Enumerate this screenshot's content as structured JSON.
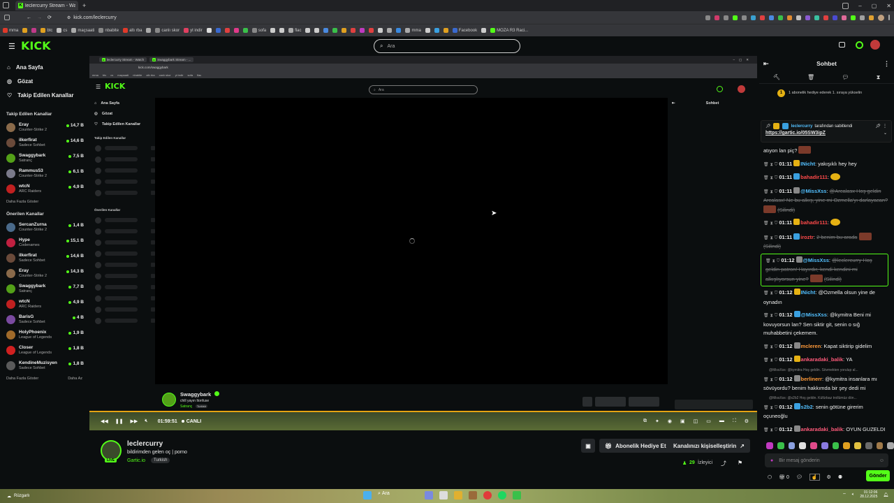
{
  "browser": {
    "tab_title": "leclercurry Stream - Watch",
    "url": "kick.com/leclercurry",
    "bookmarks": [
      "mma",
      "btc",
      "cs",
      "maçsaati",
      "nbabite",
      "altı rba",
      "canlı skor",
      "yt indir",
      "sofa",
      "flac",
      "Facebook",
      "MOZA R3 Raci..."
    ]
  },
  "kick": {
    "logo": "KICK",
    "search_placeholder": "Ara"
  },
  "sidebar": {
    "nav": [
      {
        "label": "Ana Sayfa",
        "icon": "home-icon"
      },
      {
        "label": "Gözat",
        "icon": "browse-icon"
      },
      {
        "label": "Takip Edilen Kanallar",
        "icon": "heart-icon"
      }
    ],
    "followed_title": "Takip Edilen Kanallar",
    "followed": [
      {
        "name": "Eray",
        "game": "Counter-Strike 2",
        "viewers": "14,7 B",
        "color": "#8a6a4a"
      },
      {
        "name": "ilkerfirat",
        "game": "Sadece Sohbet",
        "viewers": "14,6 B",
        "color": "#6a4a3a"
      },
      {
        "name": "Swaggybark",
        "game": "Satranç",
        "viewers": "7,5 B",
        "color": "#53a018"
      },
      {
        "name": "Rammus53",
        "game": "Counter-Strike 2",
        "viewers": "6,1 B",
        "color": "#7a7a8a"
      },
      {
        "name": "wtcN",
        "game": "ARC Raiders",
        "viewers": "4,9 B",
        "color": "#c02020"
      }
    ],
    "show_more": "Daha Fazla Göster",
    "recommended_title": "Önerilen Kanallar",
    "recommended": [
      {
        "name": "SercanZurna",
        "game": "Counter-Strike 2",
        "viewers": "1,4 B",
        "color": "#4a6a8a"
      },
      {
        "name": "Hype",
        "game": "Codenames",
        "viewers": "15,1 B",
        "color": "#c02040"
      },
      {
        "name": "ilkerfirat",
        "game": "Sadece Sohbet",
        "viewers": "14,6 B",
        "color": "#6a4a3a"
      },
      {
        "name": "Eray",
        "game": "Counter-Strike 2",
        "viewers": "14,3 B",
        "color": "#8a6a4a"
      },
      {
        "name": "Swaggybark",
        "game": "Satranç",
        "viewers": "7,7 B",
        "color": "#53a018"
      },
      {
        "name": "wtcN",
        "game": "ARC Raiders",
        "viewers": "4,9 B",
        "color": "#c02020"
      },
      {
        "name": "BarisG",
        "game": "Sadece Sohbet",
        "viewers": "4 B",
        "color": "#7a4aa0"
      },
      {
        "name": "HolyPhoenix",
        "game": "League of Legends",
        "viewers": "1,9 B",
        "color": "#a06a2a"
      },
      {
        "name": "Closer",
        "game": "League of Legends",
        "viewers": "1,8 B",
        "color": "#d02020"
      },
      {
        "name": "KendineMuzisyen",
        "game": "Sadece Sohbet",
        "viewers": "1,8 B",
        "color": "#5a5a5a"
      }
    ],
    "show_more2": "Daha Fazla Göster",
    "show_less": "Daha Az"
  },
  "embedded": {
    "tab1": "leclercurry Stream - Watch",
    "tab2": "Swaggybark Stream - ...",
    "url": "kick.com/swaggybark",
    "search_placeholder": "Ara",
    "nav": [
      "Ana Sayfa",
      "Gözat",
      "Takip Edilen Kanallar"
    ],
    "followed_title": "Takip Edilen Kanallar",
    "recommended_title": "Önerilen Kanallar",
    "chat_title": "Sohbet",
    "streamer": "Swaggybark",
    "stream_title": "chill yayın Itonfuse",
    "category": "Satranç",
    "language": "Turkish",
    "live": "LIVE"
  },
  "player": {
    "time": "01:59:51",
    "live_label": "CANLI"
  },
  "stream": {
    "streamer": "leclercurry",
    "title": "bildirimden gelen oç | porno",
    "category": "Gartic.io",
    "language": "Turkish",
    "live": "LIVE",
    "gift_btn": "Abonelik Hediye Et",
    "customize_btn": "Kanalınızı kişiselleştirin",
    "viewers": "29",
    "viewers_label": "İzleyici"
  },
  "chat": {
    "title": "Sohbet",
    "sub_banner": "1 abonelik hediye ederek 1. sıraya yükselin",
    "pinned_by": "leclercurry",
    "pinned_suffix": "tarafından sabitlendi",
    "pinned_link": "https://gartic.io/05SW3ipZ",
    "messages": [
      {
        "time": "",
        "user": "",
        "user_color": "#eee",
        "text": "atıyon lan piç?",
        "deleted": false
      },
      {
        "time": "01:11",
        "user": "INicht",
        "user_color": "#53c0ff",
        "text": "yakışıklı hey hey",
        "deleted": false
      },
      {
        "time": "01:11",
        "user": "bahadir111",
        "user_color": "#ff4a4a",
        "text": "",
        "deleted": false
      },
      {
        "time": "01:11",
        "user": "@MissXss",
        "user_color": "#53c0ff",
        "text": "@Arcalasx Hoş geldin Arcalasx! Ne bu alkış, yine mi Ozmella'yı darlayacan?",
        "deleted": true,
        "deleted_label": "(Silindi)"
      },
      {
        "time": "01:11",
        "user": "bahadir111",
        "user_color": "#ff4a4a",
        "text": "",
        "deleted": false
      },
      {
        "time": "01:11",
        "user": "iroztr",
        "user_color": "#ff4a4a",
        "text": "2 benim bu arada",
        "deleted": true,
        "deleted_label": "(Silindi)"
      },
      {
        "time": "01:12",
        "user": "@MissXss",
        "user_color": "#53c0ff",
        "text": "@leclercurry Hoş geldin patron! Hayırdır, kendi kendini mi alkışlıyorsun yine?",
        "deleted": true,
        "deleted_label": "(Silindi)"
      },
      {
        "time": "01:12",
        "user": "INicht",
        "user_color": "#53c0ff",
        "text": "@Ozmella olsun yine de oynadın",
        "deleted": false
      },
      {
        "time": "01:12",
        "user": "@MissXss",
        "user_color": "#53c0ff",
        "text": "@kymitra Beni mi kovuyorsun lan? Sen siktir git, senin o sığ muhabbetini çekemem.",
        "deleted": false
      },
      {
        "time": "01:12",
        "user": "mcleren",
        "user_color": "#ff9a3a",
        "text": "Kapat siktirip gidelim",
        "deleted": false
      },
      {
        "time": "01:12",
        "user": "ankaradaki_balik",
        "user_color": "#ff5a7a",
        "text": "YA",
        "deleted": false
      },
      {
        "reply": "@MissXss: @kymitra Hoş geldin. Sövmekten yorulup al..."
      },
      {
        "time": "01:12",
        "user": "berlinerr",
        "user_color": "#ff9a3a",
        "text": "@kymitra insanlara mı sövüyordu? benim hakkımda bir şey dedi mi",
        "deleted": false
      },
      {
        "reply": "@MissXss: @s2b2 Hoş geldin. Küfürbaz trollümüz dön..."
      },
      {
        "time": "01:12",
        "user": "s2b2",
        "user_color": "#53c0ff",
        "text": "senin götüne girerim oçuneoğlu",
        "deleted": false
      },
      {
        "time": "01:12",
        "user": "ankaradaki_balik",
        "user_color": "#ff5a7a",
        "text": "OYUN GUZELDI",
        "deleted": false
      }
    ],
    "input_placeholder": "Bir mesaj gönderin",
    "points": "0",
    "send_label": "Gönder"
  },
  "taskbar": {
    "weather": "Rüzgarlı",
    "search": "Ara",
    "clock_time": "01:12:06",
    "clock_date": "28.12.2025"
  }
}
